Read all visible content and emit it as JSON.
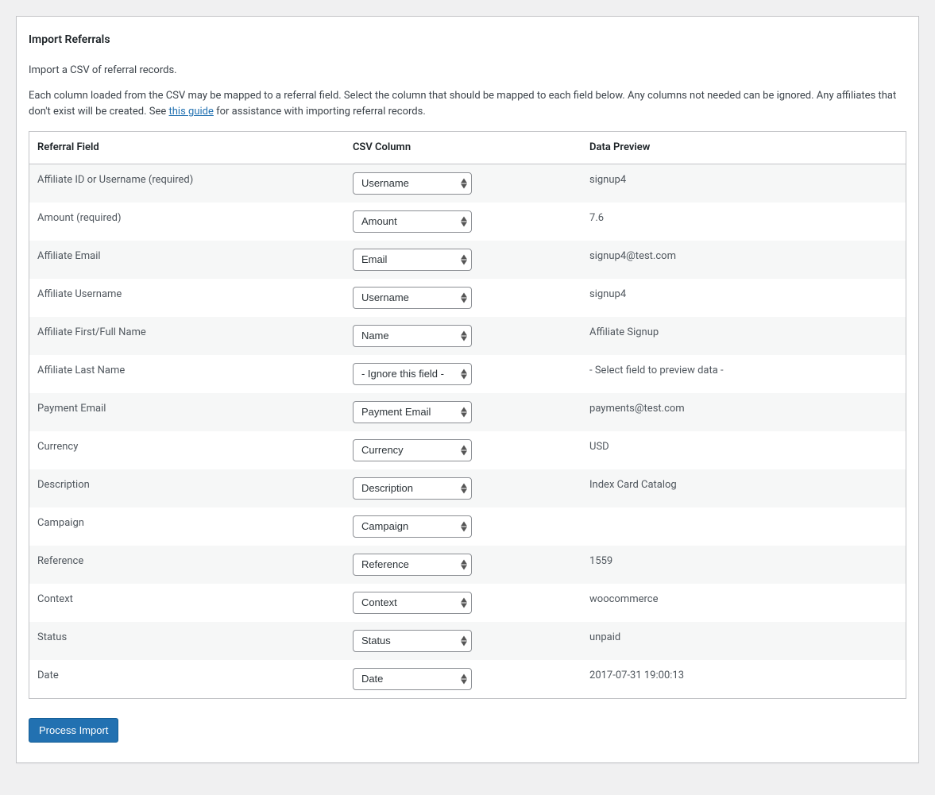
{
  "page": {
    "title": "Import Referrals",
    "intro": "Import a CSV of referral records.",
    "instructions_pre": "Each column loaded from the CSV may be mapped to a referral field. Select the column that should be mapped to each field below. Any columns not needed can be ignored. Any affiliates that don't exist will be created. See ",
    "instructions_link": "this guide",
    "instructions_post": " for assistance with importing referral records."
  },
  "table": {
    "headers": {
      "field": "Referral Field",
      "csv": "CSV Column",
      "preview": "Data Preview"
    },
    "rows": [
      {
        "field": "Affiliate ID or Username (required)",
        "csv": "Username",
        "preview": "signup4"
      },
      {
        "field": "Amount (required)",
        "csv": "Amount",
        "preview": "7.6"
      },
      {
        "field": "Affiliate Email",
        "csv": "Email",
        "preview": "signup4@test.com"
      },
      {
        "field": "Affiliate Username",
        "csv": "Username",
        "preview": "signup4"
      },
      {
        "field": "Affiliate First/Full Name",
        "csv": "Name",
        "preview": "Affiliate Signup"
      },
      {
        "field": "Affiliate Last Name",
        "csv": "- Ignore this field -",
        "preview": "- Select field to preview data -"
      },
      {
        "field": "Payment Email",
        "csv": "Payment Email",
        "preview": "payments@test.com"
      },
      {
        "field": "Currency",
        "csv": "Currency",
        "preview": "USD"
      },
      {
        "field": "Description",
        "csv": "Description",
        "preview": "Index Card Catalog"
      },
      {
        "field": "Campaign",
        "csv": "Campaign",
        "preview": ""
      },
      {
        "field": "Reference",
        "csv": "Reference",
        "preview": "1559"
      },
      {
        "field": "Context",
        "csv": "Context",
        "preview": "woocommerce"
      },
      {
        "field": "Status",
        "csv": "Status",
        "preview": "unpaid"
      },
      {
        "field": "Date",
        "csv": "Date",
        "preview": "2017-07-31 19:00:13"
      }
    ]
  },
  "actions": {
    "process": "Process Import"
  }
}
